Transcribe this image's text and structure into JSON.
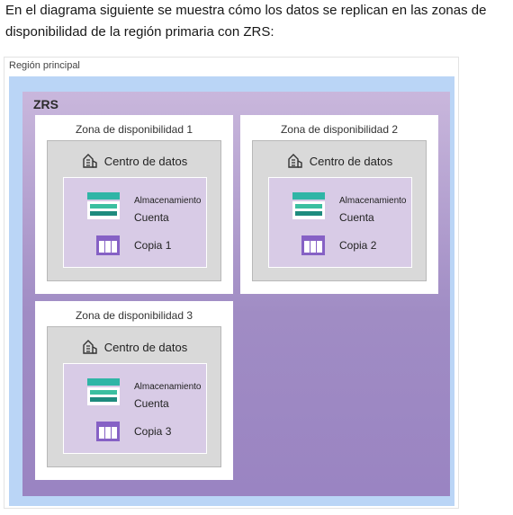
{
  "intro_text": "En el diagrama siguiente se muestra cómo los datos se replican en las zonas de disponibilidad de la región primaria con ZRS:",
  "diagram": {
    "region_label": "Región principal",
    "zrs_label": "ZRS",
    "zones": [
      {
        "label": "Zona de disponibilidad 1",
        "datacenter": "Centro de datos",
        "account_line1": "Almacenamiento",
        "account_line2": "Cuenta",
        "copy": "Copia 1"
      },
      {
        "label": "Zona de disponibilidad 2",
        "datacenter": "Centro de datos",
        "account_line1": "Almacenamiento",
        "account_line2": "Cuenta",
        "copy": "Copia 2"
      },
      {
        "label": "Zona de disponibilidad 3",
        "datacenter": "Centro de datos",
        "account_line1": "Almacenamiento",
        "account_line2": "Cuenta",
        "copy": "Copia 3"
      }
    ],
    "colors": {
      "region_background": "#bad5f6",
      "zrs_background": "#a08cc4",
      "storage_icon": "#2fb5a6",
      "copy_icon": "#8661c5"
    },
    "icons": [
      "datacenter-icon",
      "storage-account-icon",
      "table-copy-icon"
    ]
  }
}
